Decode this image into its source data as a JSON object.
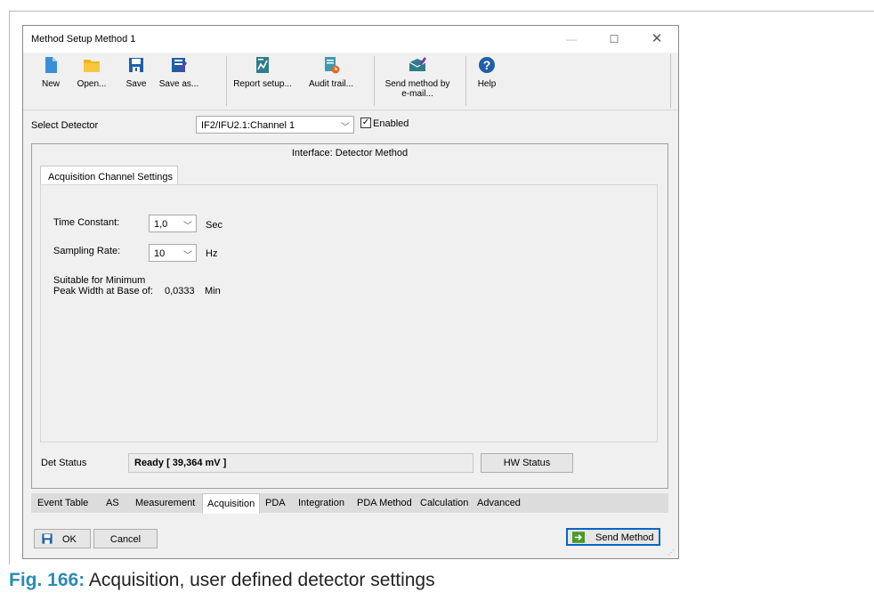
{
  "window": {
    "title": "Method Setup Method 1",
    "minimize_glyph": "—",
    "maximize_glyph": "☐",
    "close_glyph": "✕"
  },
  "toolbar": {
    "new": "New",
    "open": "Open...",
    "save": "Save",
    "save_as": "Save as...",
    "report_setup": "Report setup...",
    "audit_trail": "Audit trail...",
    "send_by_email_line1": "Send method by",
    "send_by_email_line2": "e-mail...",
    "help": "Help"
  },
  "detector": {
    "label": "Select Detector",
    "selected": "IF2/IFU2.1:Channel 1",
    "enabled_label": "Enabled",
    "enabled_checked": true
  },
  "panel": {
    "title": "Interface: Detector Method",
    "tab_label": "Acquisition Channel Settings"
  },
  "settings": {
    "time_constant_label": "Time Constant:",
    "time_constant_value": "1,0",
    "time_constant_unit": "Sec",
    "sampling_rate_label": "Sampling Rate:",
    "sampling_rate_value": "10",
    "sampling_rate_unit": "Hz",
    "suitable_line1": "Suitable for Minimum",
    "suitable_line2": "Peak Width at Base of:",
    "peak_width_value": "0,0333",
    "peak_width_unit": "Min"
  },
  "status": {
    "label": "Det Status",
    "value": "Ready [ 39,364 mV ]",
    "hw_button": "HW Status"
  },
  "bottom_tabs": [
    "Event Table",
    "AS",
    "Measurement",
    "Acquisition",
    "PDA",
    "Integration",
    "PDA Method",
    "Calculation",
    "Advanced"
  ],
  "active_tab": "Acquisition",
  "footer": {
    "ok": "OK",
    "cancel": "Cancel",
    "send_method": "Send Method"
  },
  "caption": {
    "fig": "Fig. 166:",
    "text": "Acquisition, user defined detector settings"
  },
  "colors": {
    "accent_blue": "#1f5fa8",
    "caption_blue": "#2a8bb7",
    "folder_yellow": "#f2b416"
  }
}
